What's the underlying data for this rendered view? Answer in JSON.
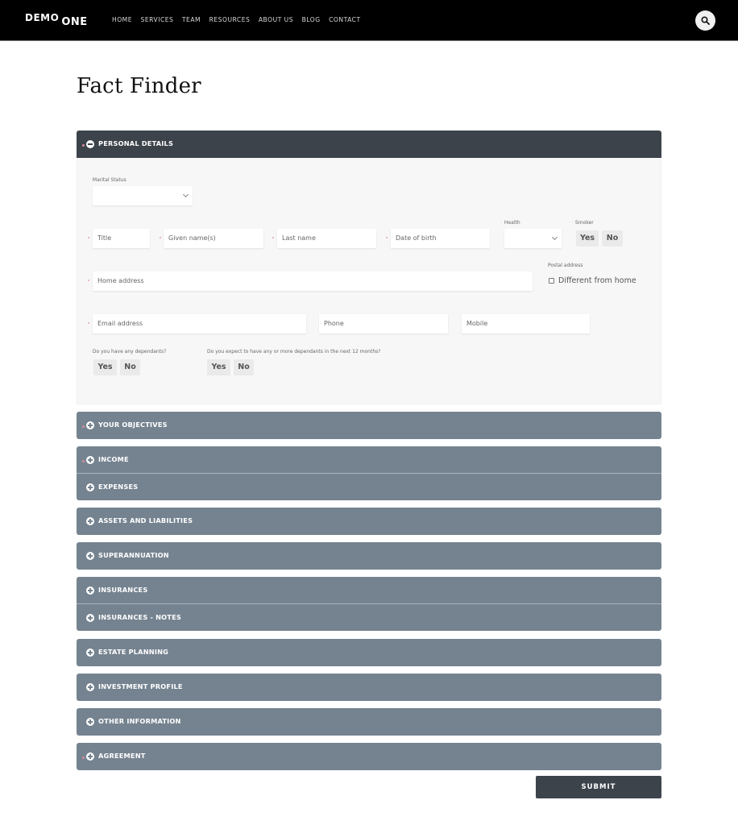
{
  "header": {
    "logo_word1": "DEMO",
    "logo_word2": "ONE",
    "nav": [
      "HOME",
      "SERVICES",
      "TEAM",
      "RESOURCES",
      "ABOUT US",
      "BLOG",
      "CONTACT"
    ],
    "search_icon": "search-icon"
  },
  "page": {
    "title": "Fact Finder"
  },
  "sections": [
    {
      "label": "PERSONAL DETAILS",
      "state": "expanded",
      "required": true,
      "icon": "minus-circle-icon"
    },
    {
      "label": "YOUR OBJECTIVES",
      "state": "collapsed",
      "required": true,
      "icon": "plus-circle-icon"
    },
    {
      "label": "INCOME",
      "state": "collapsed",
      "required": true,
      "icon": "plus-circle-icon"
    },
    {
      "label": "EXPENSES",
      "state": "collapsed",
      "required": false,
      "icon": "plus-circle-icon"
    },
    {
      "label": "ASSETS AND LIABILITIES",
      "state": "collapsed",
      "required": false,
      "icon": "plus-circle-icon"
    },
    {
      "label": "SUPERANNUATION",
      "state": "collapsed",
      "required": false,
      "icon": "plus-circle-icon"
    },
    {
      "label": "INSURANCES",
      "state": "collapsed",
      "required": false,
      "icon": "plus-circle-icon"
    },
    {
      "label": "INSURANCES - NOTES",
      "state": "collapsed",
      "required": false,
      "icon": "plus-circle-icon"
    },
    {
      "label": "ESTATE PLANNING",
      "state": "collapsed",
      "required": false,
      "icon": "plus-circle-icon"
    },
    {
      "label": "INVESTMENT PROFILE",
      "state": "collapsed",
      "required": false,
      "icon": "plus-circle-icon"
    },
    {
      "label": "OTHER INFORMATION",
      "state": "collapsed",
      "required": false,
      "icon": "plus-circle-icon"
    },
    {
      "label": "AGREEMENT",
      "state": "collapsed",
      "required": true,
      "icon": "plus-circle-icon"
    }
  ],
  "personal_details": {
    "marital_status": {
      "label": "Marital Status",
      "value": ""
    },
    "title": {
      "placeholder": "Title",
      "value": ""
    },
    "given_names": {
      "placeholder": "Given name(s)",
      "value": ""
    },
    "last_name": {
      "placeholder": "Last name",
      "value": ""
    },
    "date_of_birth": {
      "placeholder": "Date of birth",
      "value": ""
    },
    "health": {
      "label": "Health",
      "value": ""
    },
    "smoker": {
      "label": "Smoker",
      "yes": "Yes",
      "no": "No"
    },
    "home_address": {
      "placeholder": "Home address",
      "value": ""
    },
    "postal_address": {
      "label": "Postal address",
      "checkbox_label": "Different from home",
      "checked": false
    },
    "email": {
      "placeholder": "Email address",
      "value": ""
    },
    "phone": {
      "placeholder": "Phone",
      "value": ""
    },
    "mobile": {
      "placeholder": "Mobile",
      "value": ""
    },
    "dependants": {
      "label": "Do you have any dependants?",
      "yes": "Yes",
      "no": "No"
    },
    "future_dependants": {
      "label": "Do you expect to have any or more dependants in the next 12 months?",
      "yes": "Yes",
      "no": "No"
    }
  },
  "submit_label": "SUBMIT"
}
